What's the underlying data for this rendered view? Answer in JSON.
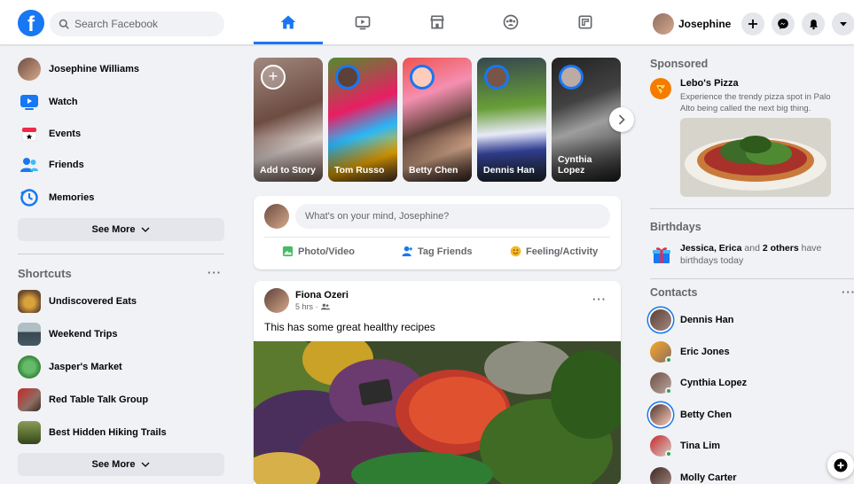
{
  "topbar": {
    "logo": "f",
    "search_placeholder": "Search Facebook",
    "nav_tabs": [
      "home-icon",
      "watch-icon",
      "marketplace-icon",
      "groups-icon",
      "gaming-icon"
    ],
    "profile_name": "Josephine",
    "accent": "#1877f2"
  },
  "sidebar": {
    "items": [
      {
        "label": "Josephine Williams",
        "icon": "avatar"
      },
      {
        "label": "Watch",
        "icon": "watch-icon"
      },
      {
        "label": "Events",
        "icon": "calendar-icon"
      },
      {
        "label": "Friends",
        "icon": "friends-icon"
      },
      {
        "label": "Memories",
        "icon": "clock-icon"
      }
    ],
    "see_more": "See More",
    "shortcuts_title": "Shortcuts",
    "shortcuts": [
      {
        "label": "Undiscovered Eats"
      },
      {
        "label": "Weekend Trips"
      },
      {
        "label": "Jasper's Market"
      },
      {
        "label": "Red Table Talk Group"
      },
      {
        "label": "Best Hidden Hiking Trails"
      }
    ],
    "see_more_2": "See More"
  },
  "stories": [
    {
      "name": "Add to Story"
    },
    {
      "name": "Tom Russo"
    },
    {
      "name": "Betty Chen"
    },
    {
      "name": "Dennis Han"
    },
    {
      "name": "Cynthia Lopez"
    }
  ],
  "composer": {
    "placeholder": "What's on your mind, Josephine?",
    "actions": [
      "Photo/Video",
      "Tag Friends",
      "Feeling/Activity"
    ]
  },
  "post": {
    "author": "Fiona Ozeri",
    "time": "5 hrs ·",
    "text": "This has some great healthy recipes"
  },
  "right": {
    "sponsored_title": "Sponsored",
    "ad_name": "Lebo's Pizza",
    "ad_text": "Experience the trendy pizza spot in Palo Alto being called the next big thing.",
    "birthdays_title": "Birthdays",
    "birthday_names": "Jessica, Erica",
    "birthday_and": " and ",
    "birthday_others": "2 others",
    "birthday_rest": " have birthdays today",
    "contacts_title": "Contacts",
    "contacts": [
      {
        "name": "Dennis Han"
      },
      {
        "name": "Eric Jones"
      },
      {
        "name": "Cynthia Lopez"
      },
      {
        "name": "Betty Chen"
      },
      {
        "name": "Tina Lim"
      },
      {
        "name": "Molly Carter"
      }
    ]
  }
}
